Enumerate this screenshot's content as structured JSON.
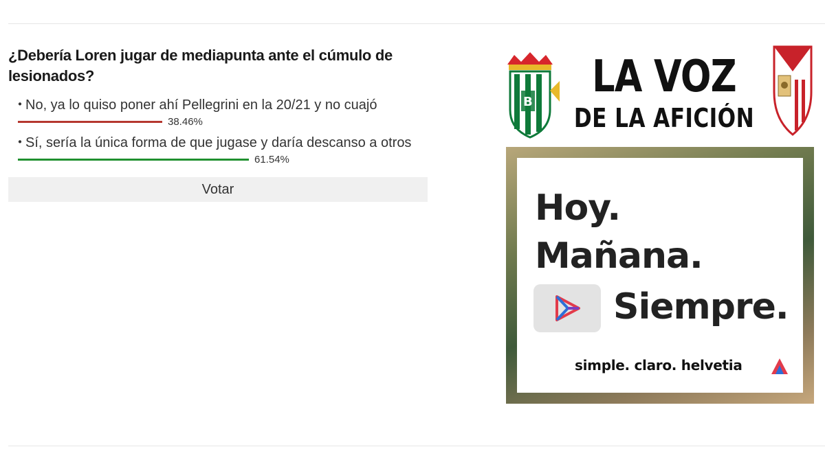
{
  "poll": {
    "question": "¿Debería Loren jugar de mediapunta ante el cúmulo de lesionados?",
    "options": [
      {
        "bullet": "・",
        "text": "No, ya lo quiso poner ahí Pellegrini en la 20/21 y no cuajó",
        "percent_label": "38.46%",
        "percent": 38.46,
        "bar_color": "#b5372f"
      },
      {
        "bullet": "・",
        "text": "Sí, sería la única forma de que jugase y daría descanso a otros",
        "percent_label": "61.54%",
        "percent": 61.54,
        "bar_color": "#20902f"
      }
    ],
    "vote_label": "Votar"
  },
  "ad": {
    "title_line1": "LA VOZ",
    "title_line2": "DE LA AFICIÓN",
    "line1": "Hoy.",
    "line2": "Mañana.",
    "line3": "Siempre.",
    "slogan": "simple. claro. helvetia",
    "left_crest_icon": "real-betis-crest-icon",
    "right_crest_icon": "sevilla-fc-crest-icon",
    "play_icon": "play-icon",
    "brand_icon": "helvetia-logo-icon"
  }
}
